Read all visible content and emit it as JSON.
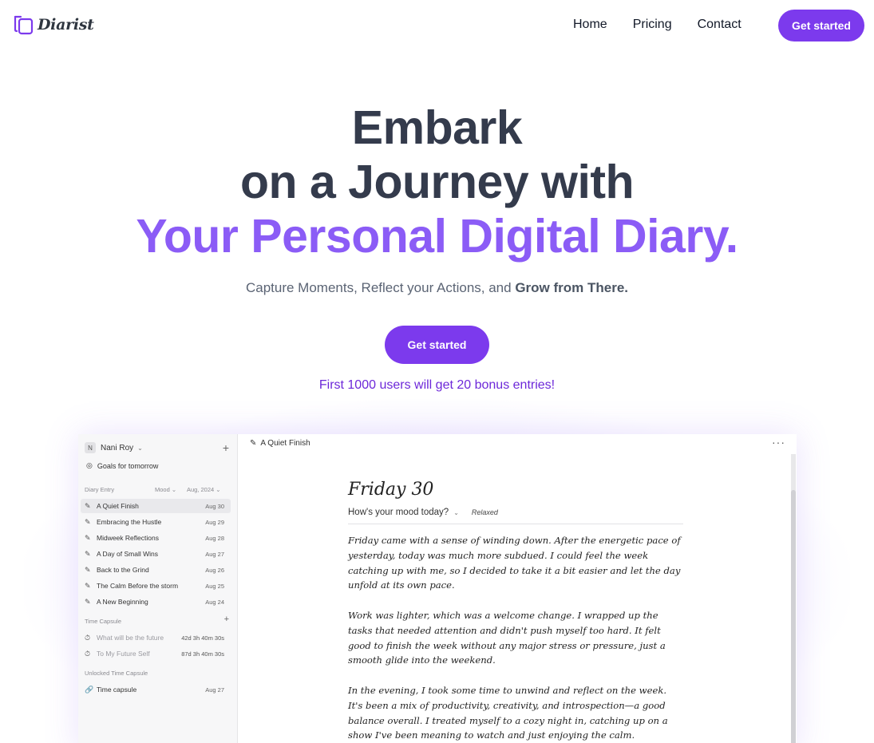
{
  "nav": {
    "logo_text": "Diarist",
    "links": [
      "Home",
      "Pricing",
      "Contact"
    ],
    "cta": "Get started"
  },
  "hero": {
    "line1": "Embark",
    "line2": "on a Journey with",
    "line3": "Your Personal Digital Diary.",
    "subtitle_plain": "Capture Moments, Reflect your Actions, and ",
    "subtitle_bold": "Grow from There.",
    "cta": "Get started",
    "bonus": "First 1000 users will get 20 bonus entries!"
  },
  "app": {
    "user": {
      "initial": "N",
      "name": "Nani Roy"
    },
    "goals": "Goals for tomorrow",
    "diary_label": "Diary Entry",
    "filter_mood": "Mood",
    "filter_month": "Aug, 2024",
    "entries": [
      {
        "title": "A Quiet Finish",
        "date": "Aug 30"
      },
      {
        "title": "Embracing the Hustle",
        "date": "Aug 29"
      },
      {
        "title": "Midweek Reflections",
        "date": "Aug 28"
      },
      {
        "title": "A Day of Small Wins",
        "date": "Aug 27"
      },
      {
        "title": "Back to the Grind",
        "date": "Aug 26"
      },
      {
        "title": "The Calm Before the storm",
        "date": "Aug 25"
      },
      {
        "title": "A New Beginning",
        "date": "Aug 24"
      }
    ],
    "capsule_label": "Time Capsule",
    "capsules": [
      {
        "title": "What will be the future",
        "time": "42d 3h 40m 30s"
      },
      {
        "title": "To My Future Self",
        "time": "87d 3h 40m 30s"
      }
    ],
    "unlocked_label": "Unlocked Time Capsule",
    "unlocked": [
      {
        "title": "Time capsule",
        "date": "Aug 27"
      }
    ],
    "tab_title": "A Quiet Finish",
    "diary_date": "Friday 30",
    "mood_question": "How's your mood today?",
    "mood_value": "Relaxed",
    "paragraphs": [
      "Friday came with a sense of winding down. After the energetic pace of yesterday, today was much more subdued. I could feel the week catching up with me, so I decided to take it a bit easier and let the day unfold at its own pace.",
      "Work was lighter, which was a welcome change. I wrapped up the tasks that needed attention and didn't push myself too hard. It felt good to finish the week without any major stress or pressure, just a smooth glide into the weekend.",
      "In the evening, I took some time to unwind and reflect on the week. It's been a mix of productivity, creativity, and introspection—a good balance overall. I treated myself to a cozy night in, catching up on a show I've been meaning to watch and just enjoying the calm."
    ]
  },
  "colors": {
    "brand": "#7c3aed",
    "accent_text": "#8b5cf6",
    "heading": "#343b4c"
  }
}
